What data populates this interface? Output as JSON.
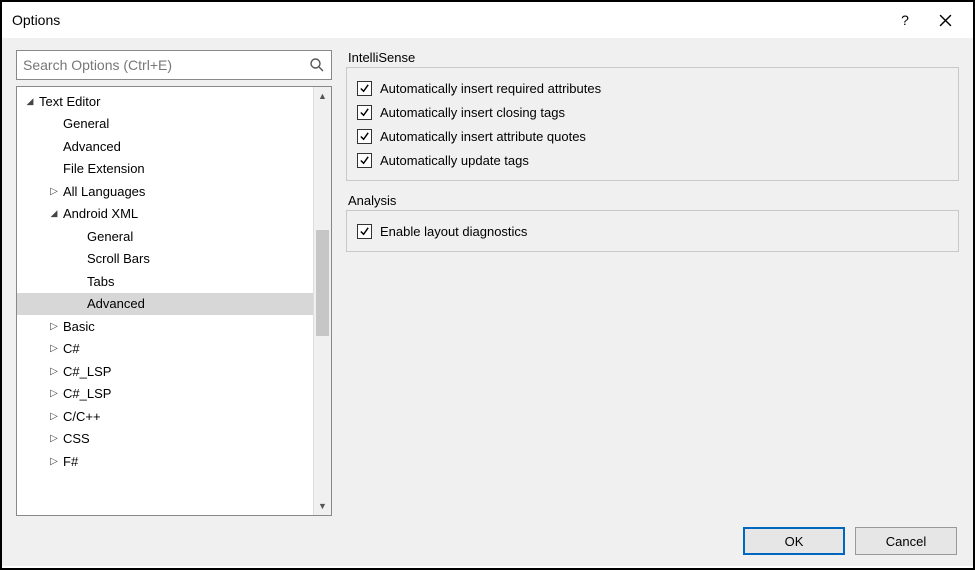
{
  "window": {
    "title": "Options",
    "help_tooltip": "?",
    "close_tooltip": "Close"
  },
  "search": {
    "placeholder": "Search Options (Ctrl+E)"
  },
  "tree": [
    {
      "label": "Text Editor",
      "depth": 0,
      "arrow": "down"
    },
    {
      "label": "General",
      "depth": 1,
      "arrow": "none"
    },
    {
      "label": "Advanced",
      "depth": 1,
      "arrow": "none"
    },
    {
      "label": "File Extension",
      "depth": 1,
      "arrow": "none"
    },
    {
      "label": "All Languages",
      "depth": 1,
      "arrow": "right"
    },
    {
      "label": "Android XML",
      "depth": 1,
      "arrow": "down"
    },
    {
      "label": "General",
      "depth": 2,
      "arrow": "none"
    },
    {
      "label": "Scroll Bars",
      "depth": 2,
      "arrow": "none"
    },
    {
      "label": "Tabs",
      "depth": 2,
      "arrow": "none"
    },
    {
      "label": "Advanced",
      "depth": 2,
      "arrow": "none",
      "selected": true
    },
    {
      "label": "Basic",
      "depth": 1,
      "arrow": "right"
    },
    {
      "label": "C#",
      "depth": 1,
      "arrow": "right"
    },
    {
      "label": "C#_LSP",
      "depth": 1,
      "arrow": "right"
    },
    {
      "label": "C#_LSP",
      "depth": 1,
      "arrow": "right"
    },
    {
      "label": "C/C++",
      "depth": 1,
      "arrow": "right"
    },
    {
      "label": "CSS",
      "depth": 1,
      "arrow": "right"
    },
    {
      "label": "F#",
      "depth": 1,
      "arrow": "right"
    }
  ],
  "groups": [
    {
      "title": "IntelliSense",
      "items": [
        {
          "label": "Automatically insert required attributes",
          "checked": true
        },
        {
          "label": "Automatically insert closing tags",
          "checked": true
        },
        {
          "label": "Automatically insert attribute quotes",
          "checked": true
        },
        {
          "label": "Automatically update tags",
          "checked": true
        }
      ]
    },
    {
      "title": "Analysis",
      "items": [
        {
          "label": "Enable layout diagnostics",
          "checked": true
        }
      ]
    }
  ],
  "buttons": {
    "ok": "OK",
    "cancel": "Cancel"
  }
}
